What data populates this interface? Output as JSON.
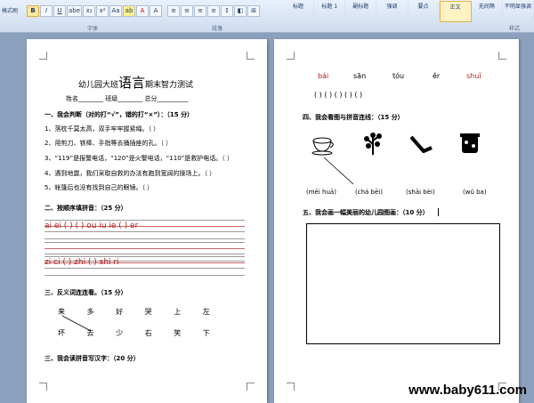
{
  "ribbon": {
    "format_painter": "格式刷",
    "groups": {
      "font": "字体",
      "paragraph": "段落",
      "styles": "样式"
    },
    "styles": [
      "标题",
      "标题 1",
      "副标题",
      "强调",
      "要点",
      "正文",
      "无间隔",
      "不明显强调"
    ],
    "selected_style": "正文",
    "buttons": [
      "B",
      "I",
      "U",
      "abe",
      "x₂",
      "x²",
      "Aa",
      "ab",
      "A",
      "A"
    ]
  },
  "page1": {
    "title_left": "幼儿园大班",
    "title_big": "语言",
    "title_right": "期末智力测试",
    "info": "姓名________  班级________  总分__________",
    "sec1": "一、我会判断（对的打“√”，错的打“×”）：（15 分）",
    "q": [
      "1、落枕千莫太高，双手牢牢握紧绳。（    ）",
      "2、用剪刀、铁棒、手指等去捅插座的孔。（    ）",
      "3、“119”是报警电话，“120”是火警电话，“110”是救护电话。（    ）",
      "4、遇到地震，我们采取自救的办法有跑到宽阔的操场上。（    ）",
      "5、帐篷后也没有找到自己的眼镜。（    ）"
    ],
    "sec2": "二、按顺序填拼音：（25 分）",
    "pinyin_row1": "ai ei (   ) (   ) ou iu  ie (   ) er",
    "pinyin_row2": "zi ci (   ) zhi (   ) shi  ri",
    "sec3": "三、反义词连连看。（15 分）",
    "ant_top": [
      "来",
      "多",
      "好",
      "哭",
      "上",
      "左"
    ],
    "ant_bottom": [
      "坏",
      "去",
      "少",
      "右",
      "笑",
      "下"
    ],
    "sec4": "三、我会读拼音写汉字：（20 分）"
  },
  "page2": {
    "pinyin": [
      "bái",
      "sān",
      "tóu",
      "ěr",
      "shuǐ"
    ],
    "blanks": "(    )      (    )      (    )      (    )      (    )",
    "sec4": "四、我会看图与拼音连线：（15 分）",
    "labels": [
      "(mēi huā)",
      "(chá bēi)",
      "(shāi bèi)",
      "(wǔ ba)"
    ],
    "sec5": "五、我会画一幅美丽的幼儿园图画：（10 分）"
  },
  "watermark": "www.baby611.com"
}
